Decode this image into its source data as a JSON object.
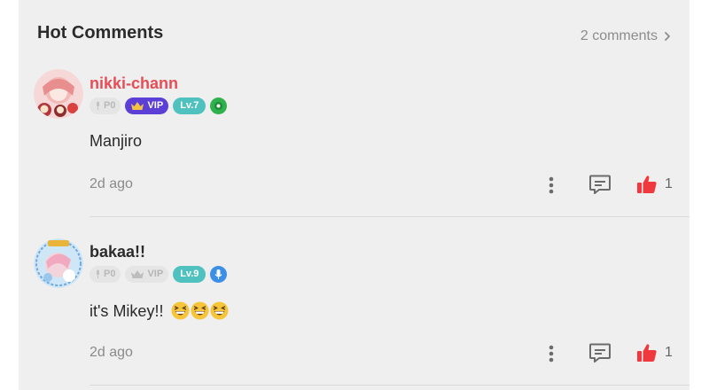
{
  "header": {
    "title": "Hot Comments",
    "comment_count": "2 comments"
  },
  "comments": [
    {
      "username": "nikki-chann",
      "username_color": "#e84d56",
      "points_badge": "P0",
      "vip_badge": "VIP",
      "vip_active": true,
      "level_badge": "Lv.7",
      "extra_badge_icon": "green-gem-icon",
      "text": "Manjiro",
      "time": "2d ago",
      "likes": "1",
      "liked": true
    },
    {
      "username": "bakaa!!",
      "username_color": "#2b2b2b",
      "points_badge": "P0",
      "vip_badge": "VIP",
      "vip_active": false,
      "level_badge": "Lv.9",
      "extra_badge_icon": "blue-microphone-icon",
      "text": "it's Mikey!!",
      "emojis": [
        "grinning-squinting-face",
        "grinning-squinting-face",
        "grinning-squinting-face"
      ],
      "time": "2d ago",
      "likes": "1",
      "liked": true
    }
  ],
  "colors": {
    "like_red": "#f0393e",
    "vip_purple": "#5c3fd6",
    "level_teal": "#4fc1be"
  }
}
